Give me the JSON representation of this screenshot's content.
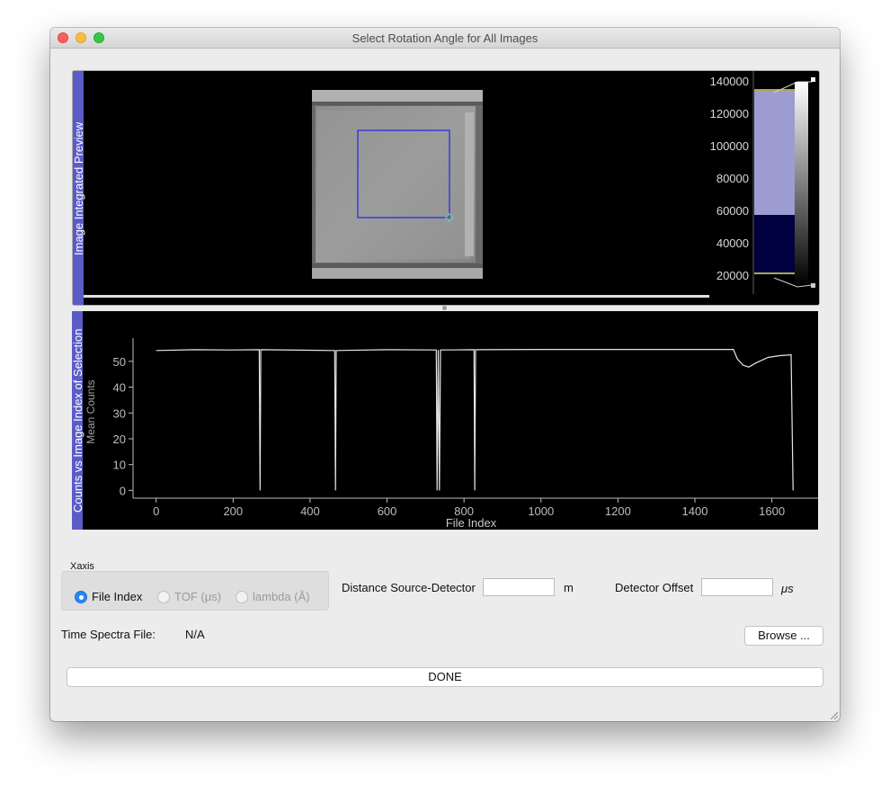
{
  "window": {
    "title": "Select Rotation Angle for All Images"
  },
  "preview_dock": {
    "title": "Image Integrated Preview"
  },
  "histogram": {
    "ticks": [
      "140000",
      "120000",
      "100000",
      "80000",
      "60000",
      "40000",
      "20000"
    ]
  },
  "plot_dock": {
    "title": "Counts vs Image Index of Selection"
  },
  "chart_data": {
    "type": "line",
    "xlabel": "File Index",
    "ylabel": "Mean Counts",
    "xlim": [
      -60,
      1720
    ],
    "ylim": [
      -3,
      59
    ],
    "x_ticks": [
      "0",
      "200",
      "400",
      "600",
      "800",
      "1000",
      "1200",
      "1400",
      "1600"
    ],
    "y_ticks": [
      "0",
      "10",
      "20",
      "30",
      "40",
      "50"
    ],
    "grid": false,
    "series": [
      {
        "points": [
          [
            0,
            54.2
          ],
          [
            100,
            54.5
          ],
          [
            200,
            54.4
          ],
          [
            268,
            54.5
          ],
          [
            270,
            0
          ],
          [
            272,
            54.5
          ],
          [
            400,
            54.3
          ],
          [
            464,
            54.2
          ],
          [
            466,
            0
          ],
          [
            468,
            54.2
          ],
          [
            600,
            54.5
          ],
          [
            728,
            54.4
          ],
          [
            730,
            0
          ],
          [
            733,
            54.4
          ],
          [
            736,
            0
          ],
          [
            739,
            54.4
          ],
          [
            826,
            54.5
          ],
          [
            828,
            0
          ],
          [
            830,
            54.5
          ],
          [
            1000,
            54.6
          ],
          [
            1200,
            54.6
          ],
          [
            1400,
            54.6
          ],
          [
            1500,
            54.6
          ],
          [
            1510,
            51
          ],
          [
            1525,
            48.5
          ],
          [
            1540,
            47.8
          ],
          [
            1560,
            49.5
          ],
          [
            1590,
            51.5
          ],
          [
            1620,
            52.2
          ],
          [
            1650,
            52.5
          ],
          [
            1655,
            0
          ]
        ]
      }
    ]
  },
  "xaxis": {
    "title": "Xaxis",
    "options": [
      {
        "label": "File Index",
        "selected": true,
        "enabled": true
      },
      {
        "label": "TOF (μs)",
        "selected": false,
        "enabled": false
      },
      {
        "label": "lambda (Å)",
        "selected": false,
        "enabled": false
      }
    ]
  },
  "distance": {
    "label": "Distance Source-Detector",
    "value": "",
    "unit": "m"
  },
  "offset": {
    "label": "Detector Offset",
    "value": "",
    "unit": "μs"
  },
  "time_spectra": {
    "label": "Time Spectra File:",
    "value": "N/A"
  },
  "browse": {
    "label": "Browse ..."
  },
  "done": {
    "label": "DONE"
  },
  "colors": {
    "dock_tab": "#5b5bc8",
    "roi": "#3b3bd6",
    "histogram_region": "#9c9cd2",
    "histogram_low": "#000040",
    "level_line": "#e8e060",
    "radio_selected": "#2a86f0"
  }
}
